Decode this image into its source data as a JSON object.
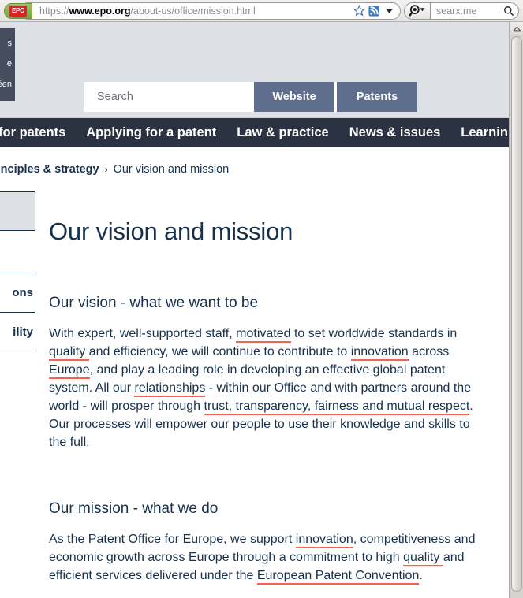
{
  "browser": {
    "favicon_label": "EPO",
    "url": {
      "scheme": "https://",
      "host": "www.epo.org",
      "path": "/about-us/office/mission.html"
    },
    "bookmark_icon": "star-icon",
    "feed_icon": "rss-feed-icon",
    "dropdown_icon": "chevron-down-icon",
    "engine_icon": "search-engine-magnifier-icon",
    "search_placeholder": "searx.me",
    "search_submit_icon": "magnifier-icon"
  },
  "site_header": {
    "language_box": [
      "s",
      "e",
      "éen"
    ],
    "search": {
      "placeholder": "Search",
      "website_label": "Website",
      "patents_label": "Patents"
    }
  },
  "main_nav": {
    "items": [
      {
        "label": "for patents"
      },
      {
        "label": "Applying for a patent"
      },
      {
        "label": "Law & practice"
      },
      {
        "label": "News & issues"
      },
      {
        "label": "Learnin"
      }
    ]
  },
  "breadcrumb": {
    "parent": "rinciples & strategy",
    "separator": "›",
    "current": "Our vision and mission"
  },
  "side_nav": {
    "items": [
      {
        "label": "",
        "active": true
      },
      {
        "label": ""
      },
      {
        "label": "ons"
      },
      {
        "label": "ility"
      }
    ]
  },
  "article": {
    "title": "Our vision and mission",
    "sections": [
      {
        "heading": "Our vision - what we want to be",
        "paragraph_runs": [
          {
            "t": "With expert, well-supported staff, ",
            "ann": false
          },
          {
            "t": "motivated",
            "ann": true
          },
          {
            "t": " to set worldwide standards in ",
            "ann": false
          },
          {
            "t": "quality ",
            "ann": true
          },
          {
            "t": "and efficiency, we will continue to contribute to ",
            "ann": false
          },
          {
            "t": "innovation",
            "ann": true
          },
          {
            "t": " across ",
            "ann": false
          },
          {
            "t": "Europe",
            "ann": true
          },
          {
            "t": ", and play a leading role in developing an effective global patent system. All our ",
            "ann": false
          },
          {
            "t": "relationships",
            "ann": true
          },
          {
            "t": " - within our Office and with partners around the world - will prosper through ",
            "ann": false
          },
          {
            "t": "trust, transparency, fairness and mutual respect",
            "ann": true
          },
          {
            "t": ". Our processes will empower our people to use their knowledge and skills to the full.",
            "ann": false
          }
        ]
      },
      {
        "heading": "Our mission - what we do",
        "paragraph_runs": [
          {
            "t": "As the Patent Office for Europe, we support ",
            "ann": false
          },
          {
            "t": "innovation",
            "ann": true
          },
          {
            "t": ", competitiveness and economic growth across Europe through a commitment to high ",
            "ann": false
          },
          {
            "t": "quality ",
            "ann": true
          },
          {
            "t": "and efficient services delivered under the ",
            "ann": false
          },
          {
            "t": "European Patent Convention",
            "ann": true
          },
          {
            "t": ".",
            "ann": false
          }
        ]
      }
    ]
  },
  "scrollbar": {
    "up_arrow_icon": "chevron-up-icon"
  },
  "colors": {
    "nav_bar": "#2b3241",
    "header_band": "#dde0e5",
    "brand_text": "#17314d",
    "button_blue": "#5f6e8d",
    "annotation_red": "#f4634f"
  }
}
